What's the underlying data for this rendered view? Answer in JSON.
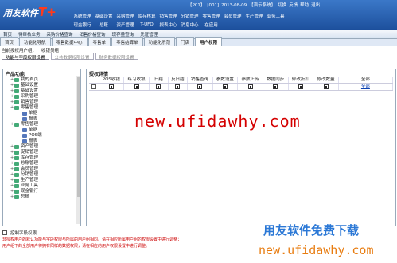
{
  "app": {
    "logo": "用友软件",
    "logo_suffix": "T+"
  },
  "status": [
    "【P01】",
    "[001]",
    "2013-08-09",
    "【演示系统】",
    "切换",
    "反馈",
    "帮助",
    "退出"
  ],
  "menu": {
    "row1": [
      "系统管理",
      "基础设置",
      "采购管理",
      "库存核算",
      "销售管理",
      "分销管理",
      "零售管理",
      "会员管理",
      "生产管理",
      "业务工具"
    ],
    "row2": [
      "现金银行",
      "总账",
      "资产管理",
      "T-UFO",
      "报表中心",
      "消息中心",
      "在应用"
    ]
  },
  "subbar": [
    "首页",
    "待审核业务",
    "采购价格查询",
    "销售价格查询",
    "现存量查询",
    "凭证管理"
  ],
  "tabs": [
    "首页",
    "功能化导航",
    "零售数据中心",
    "零售单",
    "零售结算单",
    "功能化示范",
    "门店",
    "用户权限"
  ],
  "current_admin": {
    "label": "当前授权用户组：",
    "value": "收银员组"
  },
  "sub_tabs": [
    "功能与字段权限设置",
    "公共数据权限设置",
    "财务数据权限设置"
  ],
  "left_panel": {
    "title": "产品功能",
    "tree": [
      {
        "label": "我的首页",
        "indent": 1,
        "leaf": false
      },
      {
        "label": "基础设置",
        "indent": 1,
        "leaf": false
      },
      {
        "label": "基础设置",
        "indent": 1,
        "leaf": false
      },
      {
        "label": "采购管理",
        "indent": 1,
        "leaf": false
      },
      {
        "label": "销售管理",
        "indent": 1,
        "leaf": false
      },
      {
        "label": "零售管理",
        "indent": 1,
        "leaf": false
      },
      {
        "label": "单据",
        "indent": 3,
        "leaf": true
      },
      {
        "label": "报表",
        "indent": 3,
        "leaf": true
      },
      {
        "label": "零售管理",
        "indent": 1,
        "leaf": false
      },
      {
        "label": "单据",
        "indent": 3,
        "leaf": true
      },
      {
        "label": "POS端",
        "indent": 3,
        "leaf": true
      },
      {
        "label": "报表",
        "indent": 3,
        "leaf": true
      },
      {
        "label": "资产管理",
        "indent": 1,
        "leaf": false
      },
      {
        "label": "促销管理",
        "indent": 1,
        "leaf": false
      },
      {
        "label": "库存管理",
        "indent": 1,
        "leaf": false
      },
      {
        "label": "总账管理",
        "indent": 1,
        "leaf": false
      },
      {
        "label": "会员管理",
        "indent": 1,
        "leaf": false
      },
      {
        "label": "分销管理",
        "indent": 1,
        "leaf": false
      },
      {
        "label": "生产管理",
        "indent": 1,
        "leaf": false
      },
      {
        "label": "业务工具",
        "indent": 1,
        "leaf": false
      },
      {
        "label": "现金银行",
        "indent": 1,
        "leaf": false
      },
      {
        "label": "总账",
        "indent": 1,
        "leaf": false
      }
    ]
  },
  "right_panel": {
    "title": "授权详情",
    "columns": [
      "",
      "POS收银",
      "练习收银",
      "日结",
      "反日结",
      "销售查询",
      "参数设置",
      "参数上传",
      "数据同步",
      "修改折扣",
      "修改数量",
      "全部"
    ],
    "row": {
      "checks": [
        false,
        true,
        true,
        true,
        true,
        true,
        true,
        true,
        true,
        true,
        true
      ],
      "all_link": "全部"
    }
  },
  "bottom": {
    "checkbox_label": "控制字段权限",
    "note1": "非授权用户的默认功能与字段权限与所属的用户组相同。请在相应所属用户组的权限设置中进行调整；",
    "note2": "用户组下的全部用户将拥有同样的数据权限，请在相应的用户权限设置中进行调整。"
  },
  "watermark": "new.ufidawhy.com",
  "brand": {
    "line1": "用友软件免费下载",
    "line2": "new.ufidawhy.com"
  }
}
